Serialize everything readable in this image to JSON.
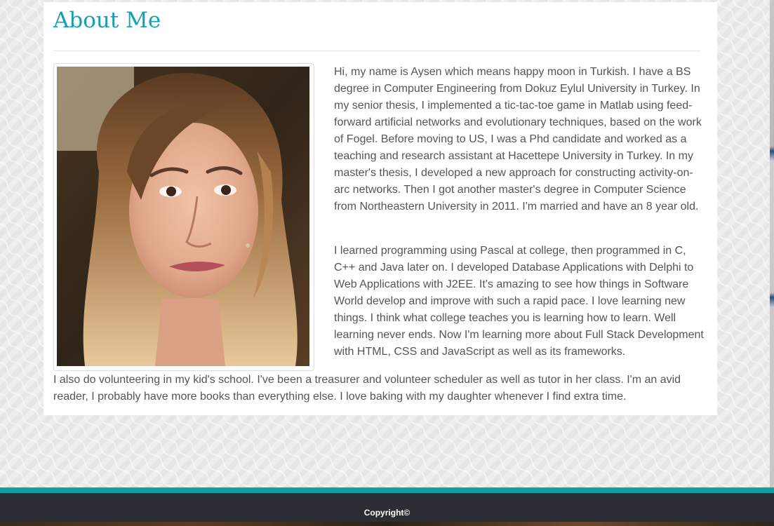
{
  "page": {
    "title": "About Me"
  },
  "photo": {
    "alt": "Portrait photo of Aysen"
  },
  "bio": {
    "paragraphs": [
      "Hi, my name is Aysen which means happy moon in Turkish. I have a BS degree in Computer Engineering from Dokuz Eylul University in Turkey. In my senior thesis, I implemented a tic-tac-toe game in Matlab using feed-forward artificial networks and evolutionary techniques, based on the work of Fogel. Before moving to US, I was a Phd candidate and worked as a teaching and research assistant at Hacettepe University in Turkey. In my master's thesis, I developed a new approach for constructing activity-on-arc networks. Then I got another master's degree in Computer Science from Northeastern University in 2011. I'm married and have an 8 year old.",
      "I learned programming using Pascal at college, then programmed in C, C++ and Java later on. I developed Database Applications with Delphi to Web Applications with J2EE. It's amazing to see how things in Software World develop and improve with such a rapid pace. I love learning new things. I think what college teaches you is learning how to learn. Well learning never ends. Now I'm learning more about Full Stack Development with HTML, CSS and JavaScript as well as its frameworks.",
      "I also do volunteering in my kid's school. I've been a treasurer and volunteer scheduler as well as tutor in her class. I'm an avid reader, I probably have more books than everything else. I love baking with my daughter whenever I find extra time."
    ]
  },
  "footer": {
    "copyright": "Copyright©"
  },
  "colors": {
    "title": "#169fb3",
    "accent_bar": "#10a0a2",
    "footer_bg": "#2b2f35",
    "body_text": "#555555"
  }
}
